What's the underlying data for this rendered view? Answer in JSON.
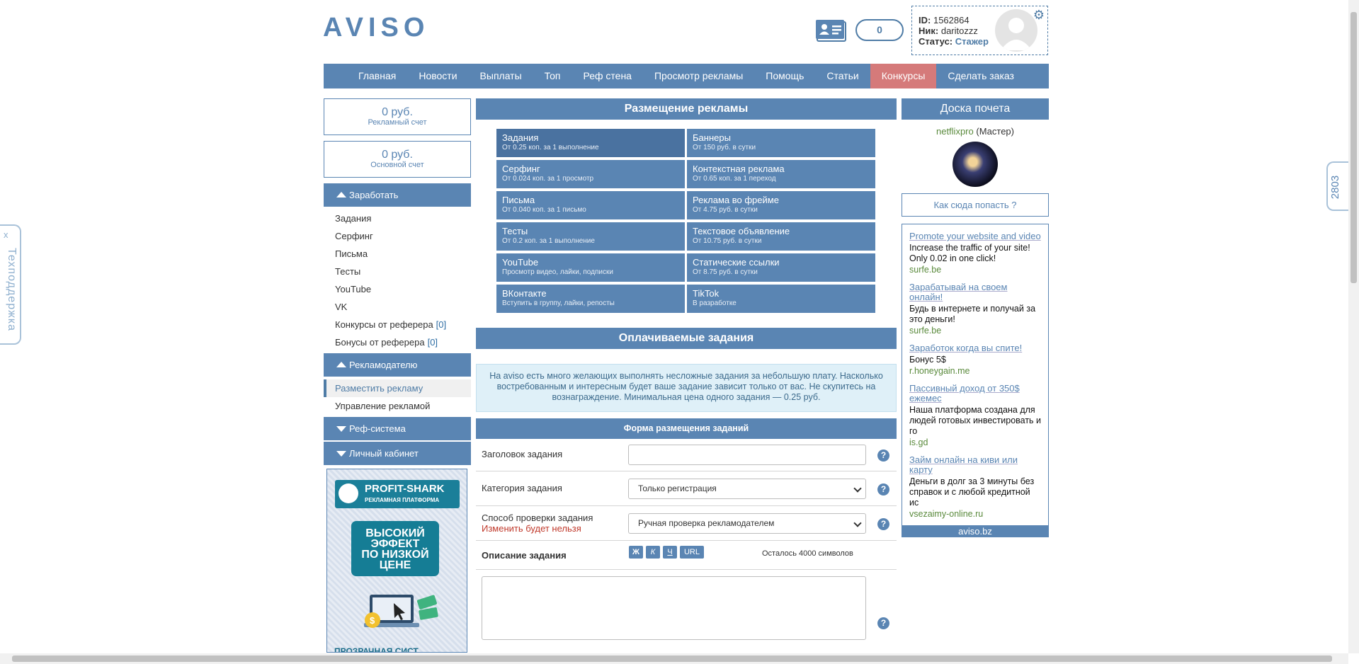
{
  "header": {
    "logo": "AVISO",
    "counter": "0",
    "user": {
      "id_label": "ID:",
      "id": "1562864",
      "nick_label": "Ник:",
      "nick": "daritozzz",
      "status_label": "Статус:",
      "status": "Стажер"
    }
  },
  "nav": [
    "Главная",
    "Новости",
    "Выплаты",
    "Топ",
    "Реф стена",
    "Просмотр рекламы",
    "Помощь",
    "Статьи",
    "Конкурсы",
    "Сделать заказ"
  ],
  "sidebar": {
    "balances": [
      {
        "amount": "0 руб.",
        "label": "Рекламный счет"
      },
      {
        "amount": "0 руб.",
        "label": "Основной счет"
      }
    ],
    "earn": {
      "title": "Заработать",
      "items": [
        "Задания",
        "Серфинг",
        "Письма",
        "Тесты",
        "YouTube",
        "VK"
      ],
      "ref_items": [
        {
          "label": "Конкурсы от реферера",
          "count": "[0]"
        },
        {
          "label": "Бонусы от реферера",
          "count": "[0]"
        }
      ]
    },
    "advertiser": {
      "title": "Рекламодателю",
      "items": [
        "Разместить рекламу",
        "Управление рекламой"
      ]
    },
    "ref_system": "Реф-система",
    "cabinet": "Личный кабинет",
    "banner": {
      "brand": "PROFIT-SHARK",
      "tagline": "РЕКЛАМНАЯ ПЛАТФОРМА",
      "l1": "ВЫСОКИЙ",
      "l2": "ЭФФЕКТ",
      "l3": "ПО НИЗКОЙ",
      "l4": "ЦЕНЕ",
      "bottom": "ПРОЗРАЧНАЯ СИСТ"
    }
  },
  "main": {
    "ads_title": "Размещение рекламы",
    "ad_types": [
      {
        "title": "Задания",
        "sub": "От 0.25 коп. за 1 выполнение"
      },
      {
        "title": "Баннеры",
        "sub": "От 150 руб. в сутки"
      },
      {
        "title": "Серфинг",
        "sub": "От 0.024 коп. за 1 просмотр"
      },
      {
        "title": "Контекстная реклама",
        "sub": "От 0.65 коп. за 1 переход"
      },
      {
        "title": "Письма",
        "sub": "От 0.040 коп. за 1 письмо"
      },
      {
        "title": "Реклама во фрейме",
        "sub": "От 4.75 руб. в сутки"
      },
      {
        "title": "Тесты",
        "sub": "От 0.2 коп. за 1 выполнение"
      },
      {
        "title": "Текстовое объявление",
        "sub": "От 10.75 руб. в сутки"
      },
      {
        "title": "YouTube",
        "sub": "Просмотр видео, лайки, подписки"
      },
      {
        "title": "Статические ссылки",
        "sub": "От 8.75 руб. в сутки"
      },
      {
        "title": "ВКонтакте",
        "sub": "Вступить в группу, лайки, репосты"
      },
      {
        "title": "TikTok",
        "sub": "В разработке"
      }
    ],
    "paid_title": "Оплачиваемые задания",
    "info": "На aviso есть много желающих выполнять несложные задания за небольшую плату. Насколько востребованным и интересным будет ваше задание зависит только от вас. Не скупитесь на вознаграждение. Минимальная цена одного задания — 0.25 руб.",
    "form": {
      "title": "Форма размещения заданий",
      "task_title_label": "Заголовок задания",
      "task_title_value": "",
      "category_label": "Категория задания",
      "category_value": "Только регистрация",
      "check_label": "Способ проверки задания",
      "check_warn": "Изменить будет нельзя",
      "check_value": "Ручная проверка рекламодателем",
      "desc_label": "Описание задания",
      "fmt_bold": "Ж",
      "fmt_italic": "К",
      "fmt_underline": "Ч",
      "fmt_url": "URL",
      "remaining": "Осталось 4000 символов",
      "help": "?"
    }
  },
  "right": {
    "title": "Доска почета",
    "user_name": "netflixpro",
    "user_rank": "(Мастер)",
    "how_link": "Как сюда попасть ?",
    "ads": [
      {
        "title": "Promote your website and video",
        "body": "Increase the traffic of your site! Only 0.02 in one click!",
        "url": "surfe.be"
      },
      {
        "title": "Зарабатывай на своем онлайн!",
        "body": "Будь в интернете и получай за это деньги!",
        "url": "surfe.be"
      },
      {
        "title": "Заработок когда вы спите!",
        "body": "Бонус 5$",
        "url": "r.honeygain.me"
      },
      {
        "title": "Пассивный доход от 350$ ежемес",
        "body": "Наша платформа создана для людей готовых инвестировать и го",
        "url": "is.gd"
      },
      {
        "title": "Займ онлайн на киви или карту",
        "body": "Деньги в долг за 3 минуты без справок и с любой кредитной ис",
        "url": "vsezaimy-online.ru"
      }
    ],
    "footer": "aviso.bz"
  },
  "support": {
    "close": "x",
    "label": "Техподдержка"
  },
  "online_count": "2803"
}
